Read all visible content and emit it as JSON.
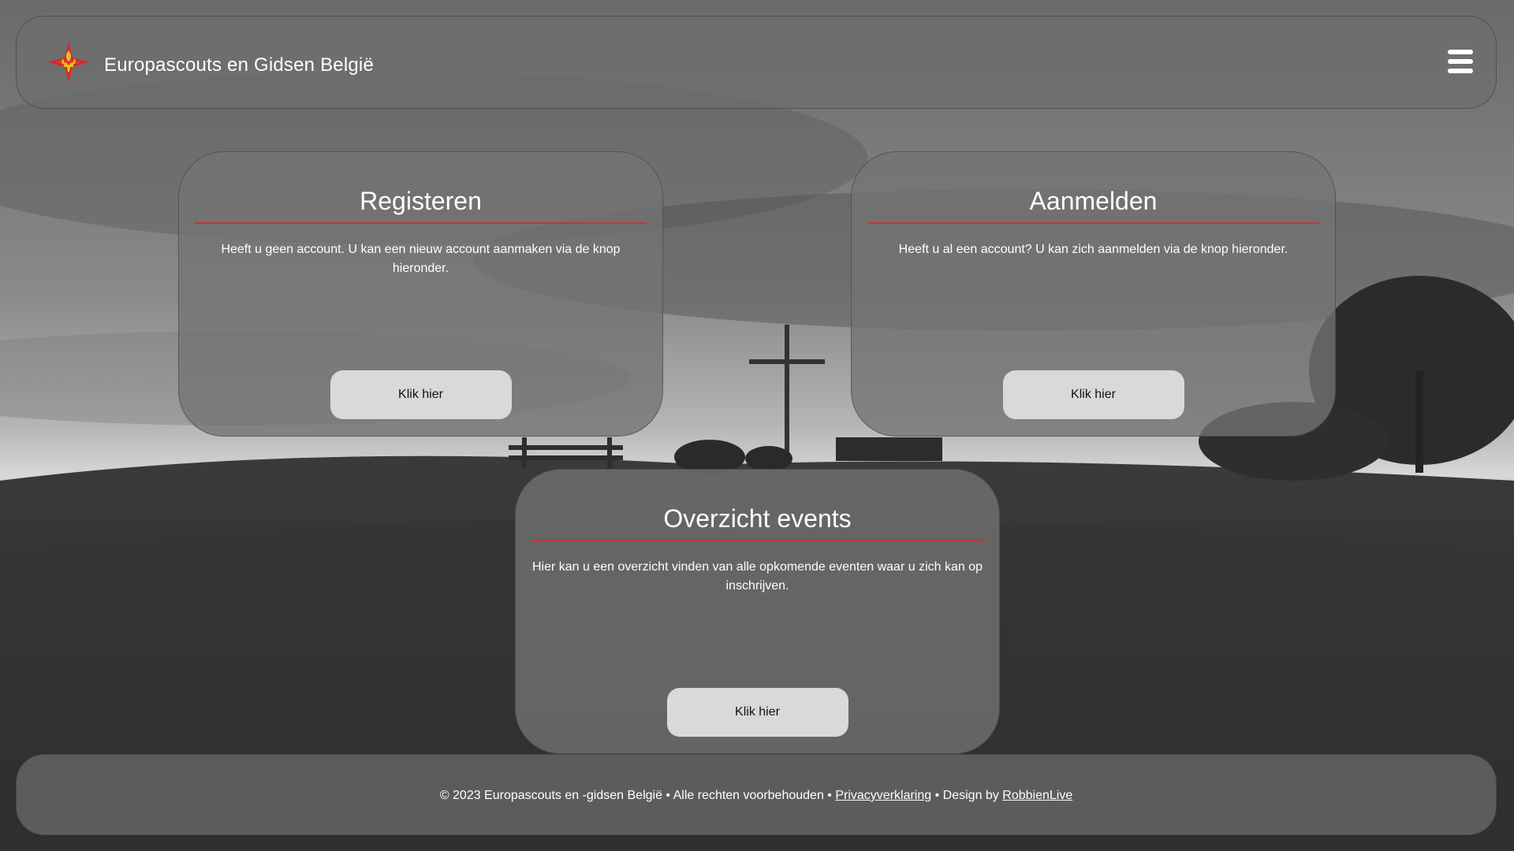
{
  "header": {
    "brand": "Europascouts en Gidsen België",
    "logo_icon": "fleur-de-lis-star-logo",
    "menu_icon": "hamburger-menu-icon"
  },
  "cards": [
    {
      "title": "Registeren",
      "text": "Heeft u geen account. U kan een nieuw account aanmaken via de knop hieronder.",
      "button_label": "Klik hier"
    },
    {
      "title": "Aanmelden",
      "text": "Heeft u al een account? U kan zich aanmelden via de knop hieronder.",
      "button_label": "Klik hier"
    },
    {
      "title": "Overzicht events",
      "text": "Hier kan u een overzicht vinden van alle opkomende eventen waar u zich kan op inschrijven.",
      "button_label": "Klik hier"
    }
  ],
  "footer": {
    "copyright": "© 2023 Europascouts en -gidsen België • Alle rechten voorbehouden •",
    "privacy_link": "Privacyverklaring",
    "design_prefix": "• Design by",
    "design_link": "RobbienLive"
  },
  "colors": {
    "accent_rule": "#b83a3a",
    "logo_red": "#d42a2a",
    "logo_gold": "#e8c020",
    "button_bg": "#d9d9d9"
  }
}
